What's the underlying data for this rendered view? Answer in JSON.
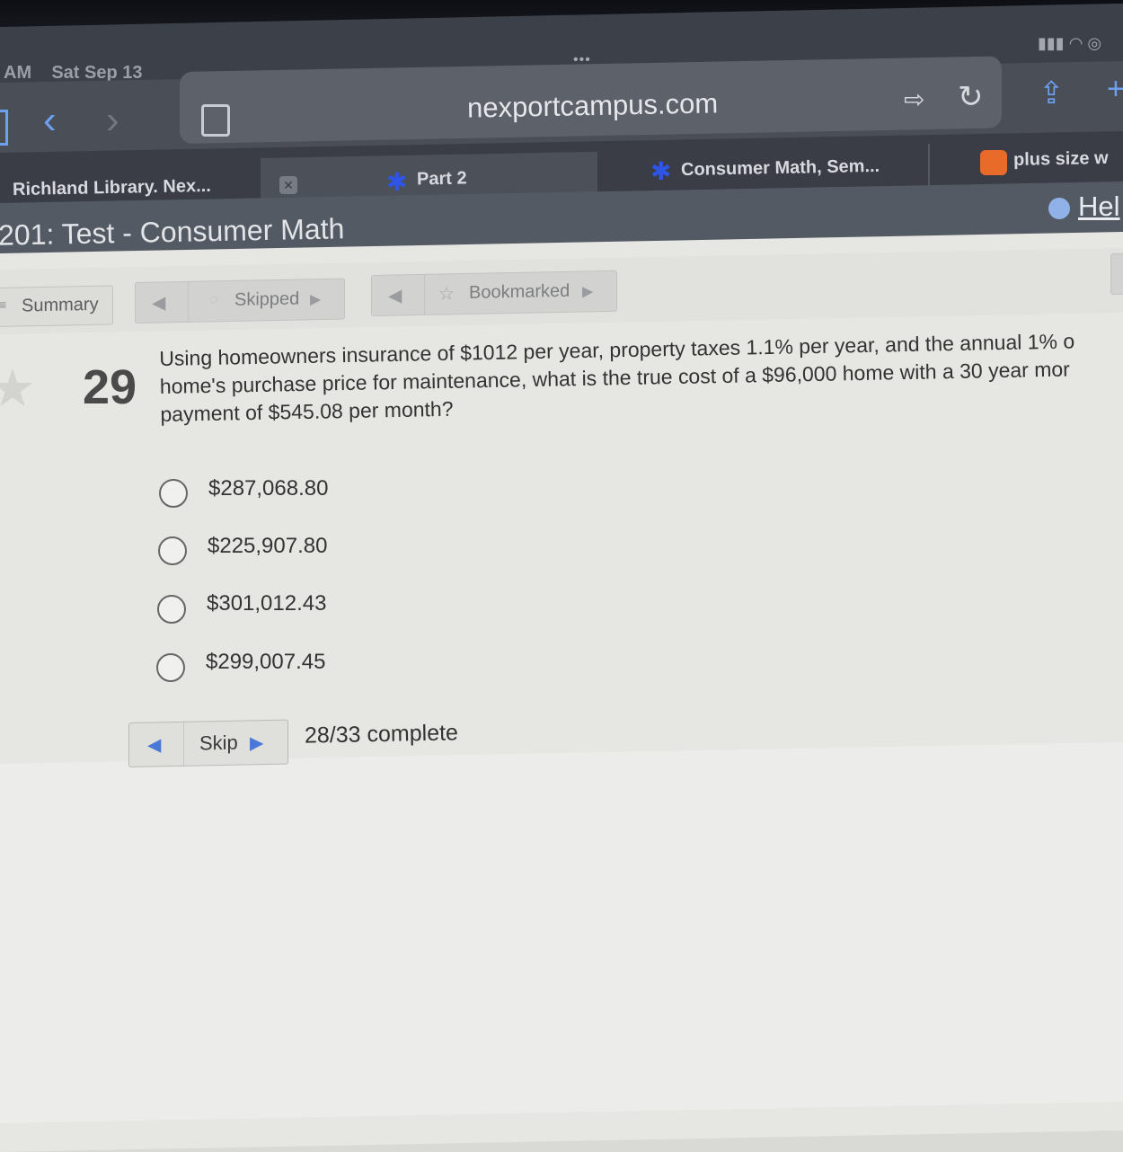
{
  "status_bar": {
    "time": "AM",
    "date": "Sat Sep 13",
    "dots": "•••"
  },
  "browser": {
    "url": "nexportcampus.com",
    "tabs": [
      {
        "label": "Richland Library. Nex..."
      },
      {
        "label": "Part 2"
      },
      {
        "label": "Consumer Math, Sem..."
      },
      {
        "label": "plus size w"
      }
    ]
  },
  "course": {
    "title": "201: Test - Consumer Math",
    "help_label": "Hel"
  },
  "toolbar": {
    "summary_label": "Summary",
    "skipped_label": "Skipped",
    "bookmarked_label": "Bookmarked"
  },
  "question": {
    "number": "29",
    "line1": "Using homeowners insurance of $1012 per year, property taxes 1.1% per year, and the annual 1% o",
    "line2": "home's purchase price for maintenance, what is the true cost of a $96,000 home with a 30 year mor",
    "line3": "payment of $545.08 per month?",
    "options": [
      {
        "label": "$287,068.80"
      },
      {
        "label": "$225,907.80"
      },
      {
        "label": "$301,012.43"
      },
      {
        "label": "$299,007.45"
      }
    ]
  },
  "footer": {
    "skip_label": "Skip",
    "progress": "28/33 complete"
  },
  "colors": {
    "accent_blue": "#6ea0f0",
    "tab_star_blue": "#2e55e6",
    "page_bg": "#e6e6e2",
    "chrome_dark": "#3a3d45"
  }
}
